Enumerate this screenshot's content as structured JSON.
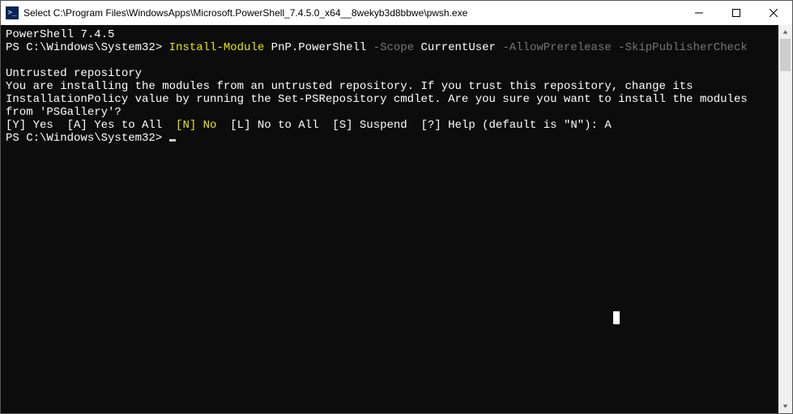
{
  "titlebar": {
    "icon_glyph": ">_",
    "title": "Select C:\\Program Files\\WindowsApps\\Microsoft.PowerShell_7.4.5.0_x64__8wekyb3d8bbwe\\pwsh.exe"
  },
  "terminal": {
    "header": "PowerShell 7.4.5",
    "prompt1_prefix": "PS C:\\Windows\\System32> ",
    "cmd_InstallModule": "Install-Module",
    "cmd_module": " PnP.PowerShell",
    "cmd_scope_param": " -Scope",
    "cmd_scope_value": " CurrentUser",
    "cmd_allow": " -AllowPrerelease",
    "cmd_skip": " -SkipPublisherCheck",
    "untrusted_heading": "Untrusted repository",
    "untrusted_body": "You are installing the modules from an untrusted repository. If you trust this repository, change its InstallationPolicy value by running the Set-PSRepository cmdlet. Are you sure you want to install the modules from 'PSGallery'?",
    "choice_yes": "[Y] Yes ",
    "choice_all": " [A] Yes to All ",
    "choice_no": " [N] No ",
    "choice_noall": " [L] No to All ",
    "choice_suspend": " [S] Suspend ",
    "choice_help": " [?] Help (default is \"N\"): ",
    "choice_answer": "A",
    "prompt2": "PS C:\\Windows\\System32> "
  }
}
